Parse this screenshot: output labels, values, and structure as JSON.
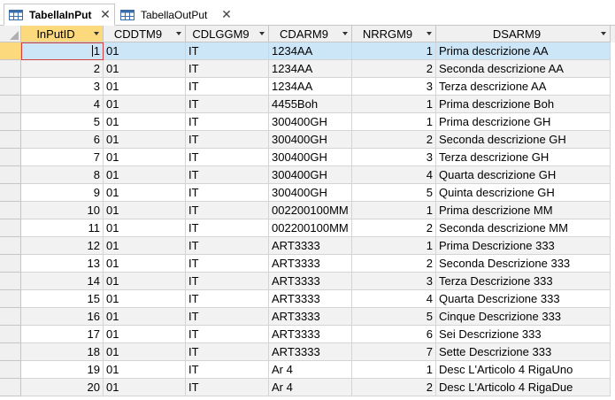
{
  "tabs": [
    {
      "label": "TabellaInPut",
      "active": true
    },
    {
      "label": "TabellaOutPut",
      "active": false
    }
  ],
  "columns": [
    "InPutID",
    "CDDTM9",
    "CDLGGM9",
    "CDARM9",
    "NRRGM9",
    "DSARM9"
  ],
  "rows": [
    {
      "id": "1",
      "cddtm9": "01",
      "cdlggm9": "IT",
      "cdarm9": "1234AA",
      "nrrgm9": "1",
      "dsarm9": "Prima descrizione AA"
    },
    {
      "id": "2",
      "cddtm9": "01",
      "cdlggm9": "IT",
      "cdarm9": "1234AA",
      "nrrgm9": "2",
      "dsarm9": "Seconda descrizione AA"
    },
    {
      "id": "3",
      "cddtm9": "01",
      "cdlggm9": "IT",
      "cdarm9": "1234AA",
      "nrrgm9": "3",
      "dsarm9": "Terza descrizione AA"
    },
    {
      "id": "4",
      "cddtm9": "01",
      "cdlggm9": "IT",
      "cdarm9": "4455Boh",
      "nrrgm9": "1",
      "dsarm9": "Prima descrizione Boh"
    },
    {
      "id": "5",
      "cddtm9": "01",
      "cdlggm9": "IT",
      "cdarm9": "300400GH",
      "nrrgm9": "1",
      "dsarm9": "Prima descrizione GH"
    },
    {
      "id": "6",
      "cddtm9": "01",
      "cdlggm9": "IT",
      "cdarm9": "300400GH",
      "nrrgm9": "2",
      "dsarm9": "Seconda descrizione GH"
    },
    {
      "id": "7",
      "cddtm9": "01",
      "cdlggm9": "IT",
      "cdarm9": "300400GH",
      "nrrgm9": "3",
      "dsarm9": "Terza descrizione GH"
    },
    {
      "id": "8",
      "cddtm9": "01",
      "cdlggm9": "IT",
      "cdarm9": "300400GH",
      "nrrgm9": "4",
      "dsarm9": "Quarta descrizione GH"
    },
    {
      "id": "9",
      "cddtm9": "01",
      "cdlggm9": "IT",
      "cdarm9": "300400GH",
      "nrrgm9": "5",
      "dsarm9": "Quinta descrizione GH"
    },
    {
      "id": "10",
      "cddtm9": "01",
      "cdlggm9": "IT",
      "cdarm9": "002200100MM",
      "nrrgm9": "1",
      "dsarm9": "Prima descrizione MM"
    },
    {
      "id": "11",
      "cddtm9": "01",
      "cdlggm9": "IT",
      "cdarm9": "002200100MM",
      "nrrgm9": "2",
      "dsarm9": "Seconda descrizione MM"
    },
    {
      "id": "12",
      "cddtm9": "01",
      "cdlggm9": "IT",
      "cdarm9": "ART3333",
      "nrrgm9": "1",
      "dsarm9": "Prima Descrizione 333"
    },
    {
      "id": "13",
      "cddtm9": "01",
      "cdlggm9": "IT",
      "cdarm9": "ART3333",
      "nrrgm9": "2",
      "dsarm9": "Seconda Descrizione 333"
    },
    {
      "id": "14",
      "cddtm9": "01",
      "cdlggm9": "IT",
      "cdarm9": "ART3333",
      "nrrgm9": "3",
      "dsarm9": "Terza Descrizione 333"
    },
    {
      "id": "15",
      "cddtm9": "01",
      "cdlggm9": "IT",
      "cdarm9": "ART3333",
      "nrrgm9": "4",
      "dsarm9": "Quarta Descrizione 333"
    },
    {
      "id": "16",
      "cddtm9": "01",
      "cdlggm9": "IT",
      "cdarm9": "ART3333",
      "nrrgm9": "5",
      "dsarm9": "Cinque Descrizione 333"
    },
    {
      "id": "17",
      "cddtm9": "01",
      "cdlggm9": "IT",
      "cdarm9": "ART3333",
      "nrrgm9": "6",
      "dsarm9": "Sei Descrizione 333"
    },
    {
      "id": "18",
      "cddtm9": "01",
      "cdlggm9": "IT",
      "cdarm9": "ART3333",
      "nrrgm9": "7",
      "dsarm9": "Sette Descrizione 333"
    },
    {
      "id": "19",
      "cddtm9": "01",
      "cdlggm9": "IT",
      "cdarm9": "Ar 4",
      "nrrgm9": "1",
      "dsarm9": "Desc L'Articolo 4 RigaUno"
    },
    {
      "id": "20",
      "cddtm9": "01",
      "cdlggm9": "IT",
      "cdarm9": "Ar 4",
      "nrrgm9": "2",
      "dsarm9": "Desc L'Articolo 4 RigaDue"
    }
  ],
  "current_row": 0,
  "colors": {
    "selected_header": "#fbd97c",
    "selected_row": "#cde6f7",
    "tab_icon": "#3b6ea8"
  },
  "icons": {
    "tab": "table-icon",
    "close": "close-icon",
    "sort": "dropdown-arrow-icon"
  }
}
